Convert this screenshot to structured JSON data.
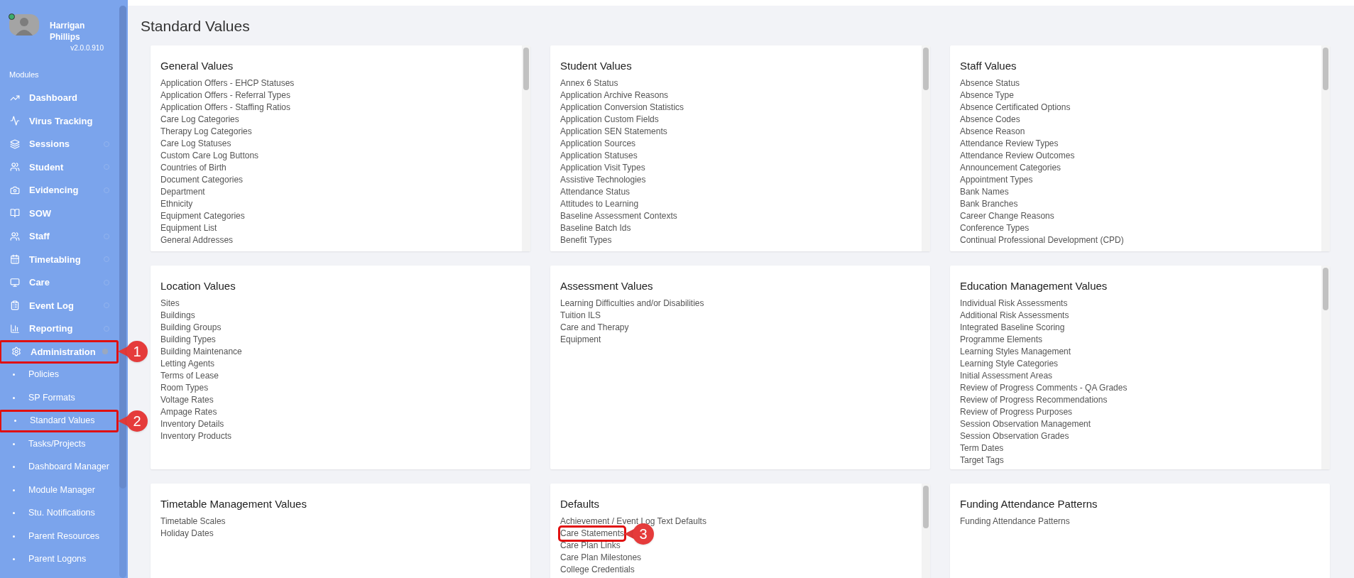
{
  "user": {
    "name": "Harrigan Phillips",
    "version": "v2.0.0.910",
    "online": true
  },
  "sidebar": {
    "heading": "Modules",
    "items": [
      {
        "label": "Dashboard",
        "kind": "link"
      },
      {
        "label": "Virus Tracking",
        "kind": "link"
      },
      {
        "label": "Sessions",
        "kind": "group",
        "expanded": false
      },
      {
        "label": "Student",
        "kind": "group",
        "expanded": false
      },
      {
        "label": "Evidencing",
        "kind": "group",
        "expanded": false
      },
      {
        "label": "SOW",
        "kind": "link"
      },
      {
        "label": "Staff",
        "kind": "group",
        "expanded": false
      },
      {
        "label": "Timetabling",
        "kind": "group",
        "expanded": false
      },
      {
        "label": "Care",
        "kind": "group",
        "expanded": false
      },
      {
        "label": "Event Log",
        "kind": "group",
        "expanded": false
      },
      {
        "label": "Reporting",
        "kind": "group",
        "expanded": false
      },
      {
        "label": "Administration",
        "kind": "group",
        "expanded": true,
        "callout": "1",
        "children": [
          {
            "label": "Policies"
          },
          {
            "label": "SP Formats"
          },
          {
            "label": "Standard Values",
            "callout": "2"
          },
          {
            "label": "Tasks/Projects"
          },
          {
            "label": "Dashboard Manager"
          },
          {
            "label": "Module Manager"
          },
          {
            "label": "Stu. Notifications"
          },
          {
            "label": "Parent Resources"
          },
          {
            "label": "Parent Logons"
          }
        ]
      }
    ]
  },
  "page_title": "Standard Values",
  "cards": [
    {
      "title": "General Values",
      "scrollable": true,
      "items": [
        {
          "label": "Application Offers - EHCP Statuses"
        },
        {
          "label": "Application Offers - Referral Types"
        },
        {
          "label": "Application Offers - Staffing Ratios"
        },
        {
          "label": "Care Log Categories"
        },
        {
          "label": "Therapy Log Categories"
        },
        {
          "label": "Care Log Statuses"
        },
        {
          "label": "Custom Care Log Buttons"
        },
        {
          "label": "Countries of Birth"
        },
        {
          "label": "Document Categories"
        },
        {
          "label": "Department"
        },
        {
          "label": "Ethnicity"
        },
        {
          "label": "Equipment Categories"
        },
        {
          "label": "Equipment List"
        },
        {
          "label": "General Addresses"
        }
      ]
    },
    {
      "title": "Student Values",
      "scrollable": true,
      "items": [
        {
          "label": "Annex 6 Status"
        },
        {
          "label": "Application Archive Reasons"
        },
        {
          "label": "Application Conversion Statistics"
        },
        {
          "label": "Application Custom Fields"
        },
        {
          "label": "Application SEN Statements"
        },
        {
          "label": "Application Sources"
        },
        {
          "label": "Application Statuses"
        },
        {
          "label": "Application Visit Types"
        },
        {
          "label": "Assistive Technologies"
        },
        {
          "label": "Attendance Status"
        },
        {
          "label": "Attitudes to Learning"
        },
        {
          "label": "Baseline Assessment Contexts"
        },
        {
          "label": "Baseline Batch Ids"
        },
        {
          "label": "Benefit Types"
        }
      ]
    },
    {
      "title": "Staff Values",
      "scrollable": true,
      "items": [
        {
          "label": "Absence Status"
        },
        {
          "label": "Absence Type"
        },
        {
          "label": "Absence Certificated Options"
        },
        {
          "label": "Absence Codes"
        },
        {
          "label": "Absence Reason"
        },
        {
          "label": "Attendance Review Types"
        },
        {
          "label": "Attendance Review Outcomes"
        },
        {
          "label": "Announcement Categories"
        },
        {
          "label": "Appointment Types"
        },
        {
          "label": "Bank Names"
        },
        {
          "label": "Bank Branches"
        },
        {
          "label": "Career Change Reasons"
        },
        {
          "label": "Conference Types"
        },
        {
          "label": "Continual Professional Development (CPD)"
        }
      ]
    },
    {
      "title": "Location Values",
      "scrollable": false,
      "items": [
        {
          "label": "Sites"
        },
        {
          "label": "Buildings"
        },
        {
          "label": "Building Groups"
        },
        {
          "label": "Building Types"
        },
        {
          "label": "Building Maintenance"
        },
        {
          "label": "Letting Agents"
        },
        {
          "label": "Terms of Lease"
        },
        {
          "label": "Room Types"
        },
        {
          "label": "Voltage Rates"
        },
        {
          "label": "Ampage Rates"
        },
        {
          "label": "Inventory Details"
        },
        {
          "label": "Inventory Products"
        }
      ]
    },
    {
      "title": "Assessment Values",
      "scrollable": false,
      "items": [
        {
          "label": "Learning Difficulties and/or Disabilities"
        },
        {
          "label": "Tuition ILS"
        },
        {
          "label": "Care and Therapy"
        },
        {
          "label": "Equipment"
        }
      ]
    },
    {
      "title": "Education Management Values",
      "scrollable": true,
      "items": [
        {
          "label": "Individual Risk Assessments"
        },
        {
          "label": "Additional Risk Assessments"
        },
        {
          "label": "Integrated Baseline Scoring"
        },
        {
          "label": "Programme Elements"
        },
        {
          "label": "Learning Styles Management"
        },
        {
          "label": "Learning Style Categories"
        },
        {
          "label": "Initial Assessment Areas"
        },
        {
          "label": "Review of Progress Comments - QA Grades"
        },
        {
          "label": "Review of Progress Recommendations"
        },
        {
          "label": "Review of Progress Purposes"
        },
        {
          "label": "Session Observation Management"
        },
        {
          "label": "Session Observation Grades"
        },
        {
          "label": "Term Dates"
        },
        {
          "label": "Target Tags"
        }
      ]
    },
    {
      "title": "Timetable Management Values",
      "scrollable": false,
      "items": [
        {
          "label": "Timetable Scales"
        },
        {
          "label": "Holiday Dates"
        }
      ]
    },
    {
      "title": "Defaults",
      "scrollable": true,
      "items": [
        {
          "label": "Achievement / Event Log Text Defaults"
        },
        {
          "label": "Care Statements",
          "callout": "3"
        },
        {
          "label": "Care Plan Links"
        },
        {
          "label": "Care Plan Milestones"
        },
        {
          "label": "College Credentials"
        }
      ]
    },
    {
      "title": "Funding Attendance Patterns",
      "scrollable": false,
      "items": [
        {
          "label": "Funding Attendance Patterns"
        }
      ]
    }
  ]
}
